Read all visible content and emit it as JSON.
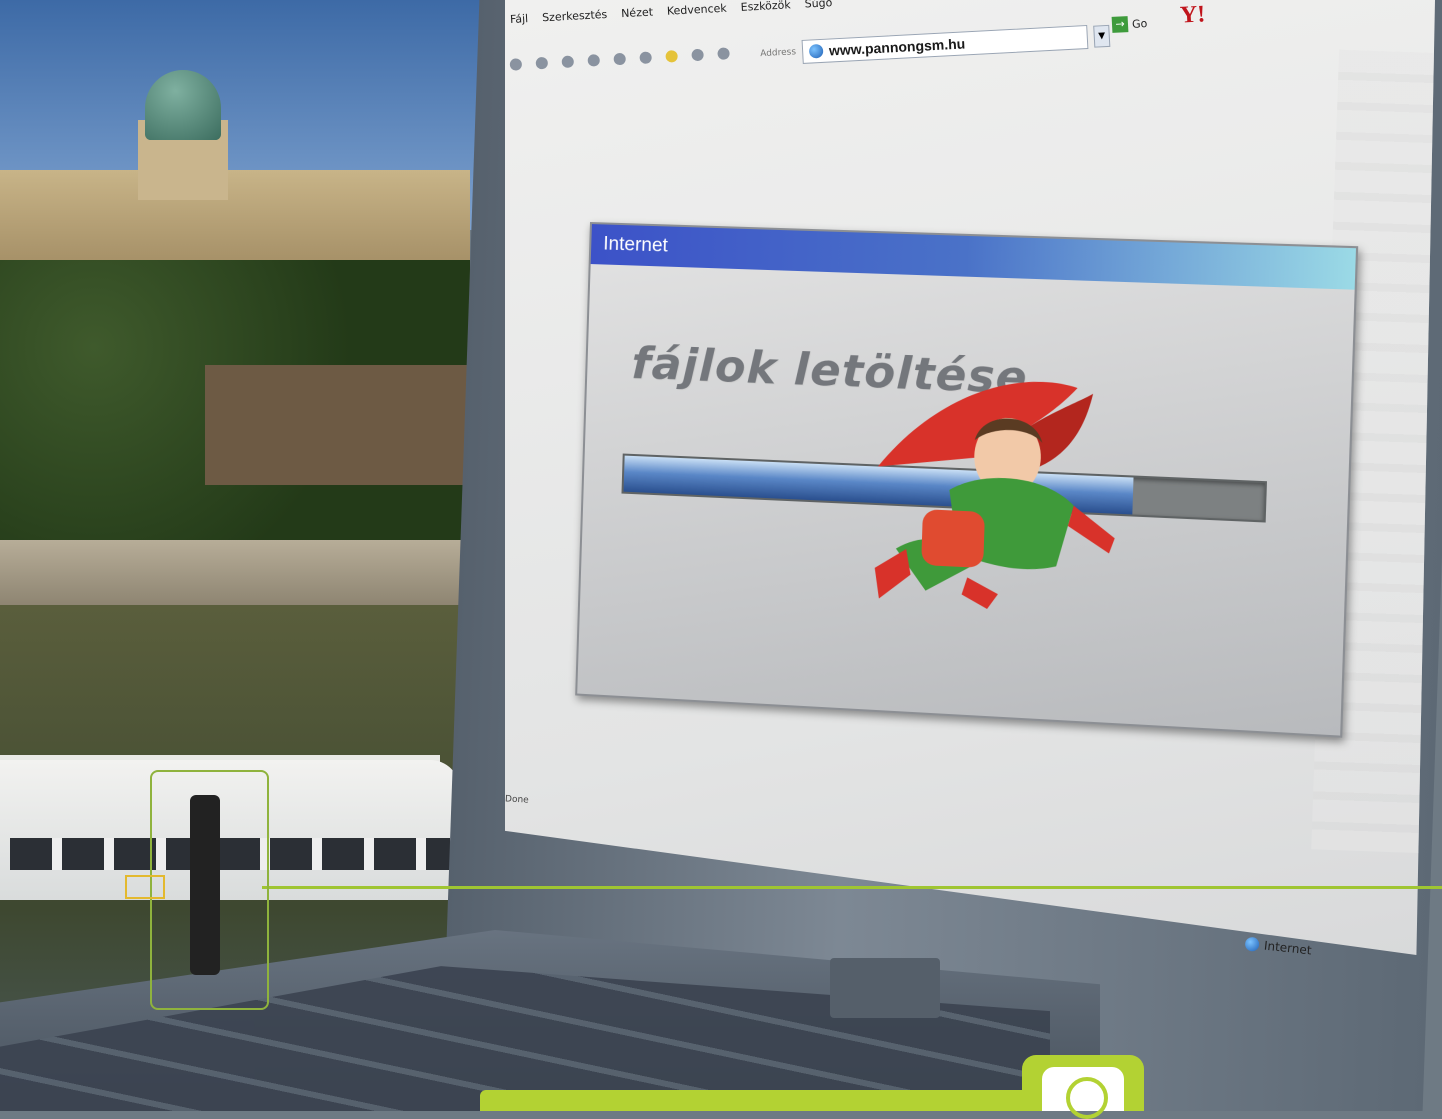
{
  "browser": {
    "menu": [
      "Fájl",
      "Szerkesztés",
      "Nézet",
      "Kedvencek",
      "Eszközök",
      "Súgó"
    ],
    "address_label": "Address",
    "url": "www.pannongsm.hu",
    "go_label": "Go",
    "yahoo_label": "Y!",
    "status_left": "Done",
    "status_zone": "Internet"
  },
  "dialog": {
    "title": "Internet",
    "headline": "fájlok letöltése",
    "progress_percent": 80
  },
  "colors": {
    "accent_green": "#b3d233",
    "dialog_title_start": "#3c52c8",
    "dialog_title_end": "#9bdae6"
  },
  "icons": {
    "toolbar": [
      "back-icon",
      "forward-icon",
      "stop-icon",
      "refresh-icon",
      "home-icon",
      "search-icon",
      "favorites-icon",
      "history-icon",
      "mail-icon"
    ]
  }
}
